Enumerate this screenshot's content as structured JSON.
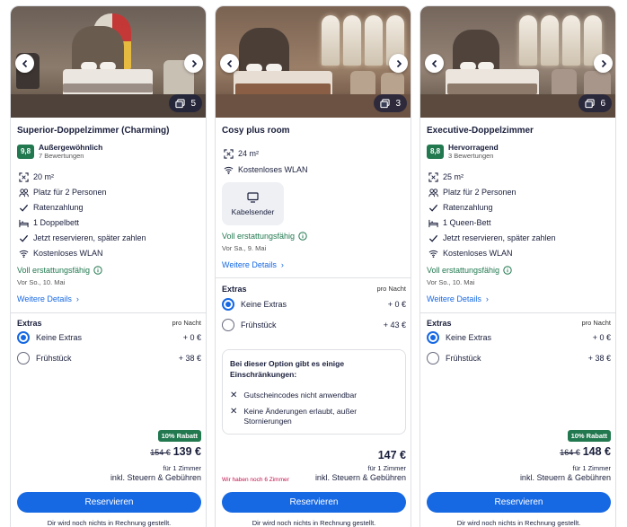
{
  "cards": [
    {
      "photo_count": "5",
      "title": "Superior-Doppelzimmer (Charming)",
      "rating": {
        "score": "9,8",
        "word": "Außergewöhnlich",
        "count": "7 Bewertungen"
      },
      "amenities": [
        {
          "icon": "area-icon",
          "text": "20 m²"
        },
        {
          "icon": "people-icon",
          "text": "Platz für 2 Personen"
        },
        {
          "icon": "check-icon",
          "text": "Ratenzahlung"
        },
        {
          "icon": "bed-icon",
          "text": "1 Doppelbett"
        },
        {
          "icon": "check-icon",
          "text": "Jetzt reservieren, später zahlen"
        },
        {
          "icon": "wifi-icon",
          "text": "Kostenloses WLAN"
        }
      ],
      "refund_text": "Voll erstattungsfähig",
      "refund_date": "Vor So., 10. Mai",
      "details_link": "Weitere Details",
      "extras_label": "Extras",
      "extras_sub": "pro Nacht",
      "options": [
        {
          "label": "Keine Extras",
          "price": "+ 0 €",
          "selected": true
        },
        {
          "label": "Frühstück",
          "price": "+ 38 €",
          "selected": false
        }
      ],
      "discount": "10% Rabatt",
      "old_price": "154 €",
      "price": "139 €",
      "per_room": "für 1 Zimmer",
      "incl": "inkl. Steuern & Gebühren",
      "reserve": "Reservieren",
      "no_charge": "Dir wird noch nichts in Rechnung gestellt."
    },
    {
      "photo_count": "3",
      "title": "Cosy plus room",
      "amenities": [
        {
          "icon": "area-icon",
          "text": "24 m²"
        },
        {
          "icon": "wifi-icon",
          "text": "Kostenloses WLAN"
        }
      ],
      "tv_label": "Kabelsender",
      "refund_text": "Voll erstattungsfähig",
      "refund_date": "Vor Sa., 9. Mai",
      "details_link": "Weitere Details",
      "extras_label": "Extras",
      "extras_sub": "pro Nacht",
      "options": [
        {
          "label": "Keine Extras",
          "price": "+ 0 €",
          "selected": true
        },
        {
          "label": "Frühstück",
          "price": "+ 43 €",
          "selected": false
        }
      ],
      "restriction_title": "Bei dieser Option gibt es einige Einschränkungen:",
      "restrictions": [
        "Gutscheincodes nicht anwendbar",
        "Keine Änderungen erlaubt, außer Stornierungen"
      ],
      "scarcity": "Wir haben noch 6 Zimmer",
      "price": "147 €",
      "per_room": "für 1 Zimmer",
      "incl": "inkl. Steuern & Gebühren",
      "reserve": "Reservieren",
      "no_charge": "Dir wird noch nichts in Rechnung gestellt."
    },
    {
      "photo_count": "6",
      "title": "Executive-Doppelzimmer",
      "rating": {
        "score": "8,8",
        "word": "Hervorragend",
        "count": "3 Bewertungen"
      },
      "amenities": [
        {
          "icon": "area-icon",
          "text": "25 m²"
        },
        {
          "icon": "people-icon",
          "text": "Platz für 2 Personen"
        },
        {
          "icon": "check-icon",
          "text": "Ratenzahlung"
        },
        {
          "icon": "bed-icon",
          "text": "1 Queen-Bett"
        },
        {
          "icon": "check-icon",
          "text": "Jetzt reservieren, später zahlen"
        },
        {
          "icon": "wifi-icon",
          "text": "Kostenloses WLAN"
        }
      ],
      "refund_text": "Voll erstattungsfähig",
      "refund_date": "Vor So., 10. Mai",
      "details_link": "Weitere Details",
      "extras_label": "Extras",
      "extras_sub": "pro Nacht",
      "options": [
        {
          "label": "Keine Extras",
          "price": "+ 0 €",
          "selected": true
        },
        {
          "label": "Frühstück",
          "price": "+ 38 €",
          "selected": false
        }
      ],
      "discount": "10% Rabatt",
      "old_price": "164 €",
      "price": "148 €",
      "per_room": "für 1 Zimmer",
      "incl": "inkl. Steuern & Gebühren",
      "reserve": "Reservieren",
      "no_charge": "Dir wird noch nichts in Rechnung gestellt."
    }
  ],
  "colors": {
    "primary": "#1668e3",
    "rating_green": "#227950",
    "scarcity": "#c1124f",
    "border": "#dfe0e4"
  }
}
